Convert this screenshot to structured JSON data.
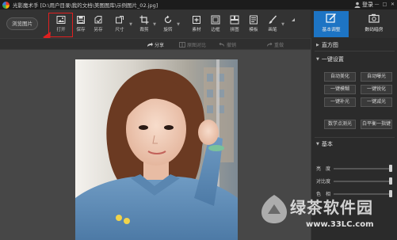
{
  "window": {
    "title": "光影魔术手 [D:\\用户目录\\我的文档\\美图图库\\示例图片_02.jpg]",
    "login": "登录",
    "controls": {
      "minimize": "—",
      "maximize": "□",
      "close": "✕"
    }
  },
  "toolbar": {
    "browse_label": "浏览图片",
    "tools": [
      {
        "label": "打开",
        "icon": "open-image-icon"
      },
      {
        "label": "保存",
        "icon": "save-icon"
      },
      {
        "label": "另存",
        "icon": "save-as-icon"
      },
      {
        "label": "尺寸",
        "icon": "resize-icon"
      },
      {
        "label": "裁剪",
        "icon": "crop-icon"
      },
      {
        "label": "旋转",
        "icon": "rotate-icon"
      },
      {
        "label": "素材",
        "icon": "material-icon"
      },
      {
        "label": "边框",
        "icon": "border-icon"
      },
      {
        "label": "拼图",
        "icon": "collage-icon"
      },
      {
        "label": "模板",
        "icon": "template-icon"
      },
      {
        "label": "画笔",
        "icon": "brush-icon"
      }
    ]
  },
  "right_tabs": [
    {
      "label": "基本调整",
      "icon": "basic-adjust-icon",
      "active": true
    },
    {
      "label": "数码暗房",
      "icon": "darkroom-icon",
      "active": false
    }
  ],
  "subbar": {
    "share": "分享",
    "compare": "原图对比",
    "undo": "撤销",
    "redo": "重做"
  },
  "panel": {
    "histogram_title": "直方图",
    "one_click_title": "一键设置",
    "buttons": [
      "自动美化",
      "自动曝光",
      "一键模糊",
      "一键锐化",
      "一键补光",
      "一键减光",
      "数学点测光",
      "白平衡一指键"
    ],
    "basic_title": "基本",
    "sliders": [
      {
        "label": "亮　度",
        "value": 1.0
      },
      {
        "label": "对比度",
        "value": 1.0
      },
      {
        "label": "色　相",
        "value": 1.0
      }
    ]
  },
  "watermark": {
    "brand": "绿茶软件园",
    "url": "www.33LC.com"
  },
  "colors": {
    "accent": "#1d74c4",
    "highlight_box": "#e02020",
    "arrow": "#e02020"
  }
}
